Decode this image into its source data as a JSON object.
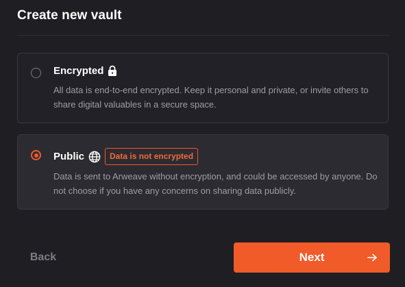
{
  "dialog": {
    "title": "Create new vault"
  },
  "options": [
    {
      "label": "Encrypted",
      "icon": "lock-icon",
      "selected": false,
      "description": "All data is end-to-end encrypted. Keep it personal and private, or invite others to share digital valuables in a secure space."
    },
    {
      "label": "Public",
      "icon": "globe-icon",
      "selected": true,
      "badge": "Data is not encrypted",
      "description": "Data is sent to Arweave without encryption, and could be accessed by anyone. Do not choose if you have any concerns on sharing data publicly."
    }
  ],
  "footer": {
    "back_label": "Back",
    "next_label": "Next",
    "next_icon": "arrow-right-icon"
  },
  "colors": {
    "accent": "#f15a29",
    "background": "#1f1e23",
    "card": "#222127",
    "card_selected": "#2c2b31",
    "text_primary": "#ffffff",
    "text_secondary": "#9e9da5"
  }
}
